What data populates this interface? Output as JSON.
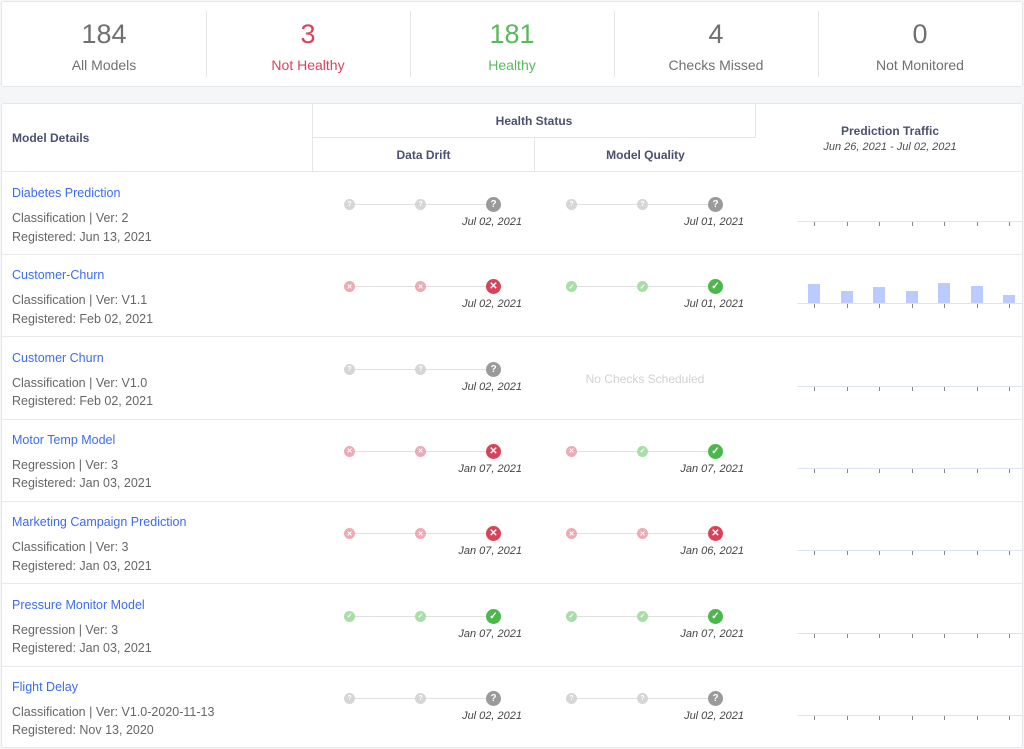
{
  "summary": [
    {
      "value": "184",
      "label": "All Models",
      "color": "#707070"
    },
    {
      "value": "3",
      "label": "Not Healthy",
      "color": "#d9435a"
    },
    {
      "value": "181",
      "label": "Healthy",
      "color": "#5cb85c"
    },
    {
      "value": "4",
      "label": "Checks Missed",
      "color": "#707070"
    },
    {
      "value": "0",
      "label": "Not Monitored",
      "color": "#707070"
    }
  ],
  "table": {
    "headers": {
      "model_details": "Model Details",
      "health_status": "Health Status",
      "data_drift": "Data Drift",
      "model_quality": "Model Quality",
      "prediction_traffic": "Prediction Traffic",
      "traffic_range": "Jun 26, 2021 - Jul 02, 2021"
    },
    "no_checks_label": "No Checks Scheduled",
    "status_icons": {
      "unknown": "question-icon",
      "fail": "x-icon",
      "pass": "check-icon"
    },
    "rows": [
      {
        "name": "Diabetes Prediction",
        "type_version": "Classification | Ver: 2",
        "registered": "Registered: Jun 13, 2021",
        "drift": {
          "statuses": [
            "unknown",
            "unknown",
            "unknown"
          ],
          "date": "Jul 02, 2021"
        },
        "quality": {
          "statuses": [
            "unknown",
            "unknown",
            "unknown"
          ],
          "date": "Jul 01, 2021"
        },
        "traffic": [
          0,
          0,
          0,
          0,
          0,
          0,
          0
        ]
      },
      {
        "name": "Customer-Churn",
        "type_version": "Classification | Ver: V1.1",
        "registered": "Registered: Feb 02, 2021",
        "drift": {
          "statuses": [
            "fail",
            "fail",
            "fail"
          ],
          "date": "Jul 02, 2021"
        },
        "quality": {
          "statuses": [
            "pass",
            "pass",
            "pass"
          ],
          "date": "Jul 01, 2021"
        },
        "traffic": [
          0.95,
          0.6,
          0.8,
          0.6,
          1.0,
          0.85,
          0.42
        ]
      },
      {
        "name": "Customer Churn",
        "type_version": "Classification | Ver: V1.0",
        "registered": "Registered: Feb 02, 2021",
        "drift": {
          "statuses": [
            "unknown",
            "unknown",
            "unknown"
          ],
          "date": "Jul 02, 2021"
        },
        "quality": null,
        "traffic": [
          0,
          0,
          0,
          0,
          0,
          0,
          0
        ]
      },
      {
        "name": "Motor Temp Model",
        "type_version": "Regression | Ver: 3",
        "registered": "Registered: Jan 03, 2021",
        "drift": {
          "statuses": [
            "fail",
            "fail",
            "fail"
          ],
          "date": "Jan 07, 2021"
        },
        "quality": {
          "statuses": [
            "fail",
            "pass",
            "pass"
          ],
          "date": "Jan 07, 2021"
        },
        "traffic": [
          0,
          0,
          0,
          0,
          0,
          0,
          0
        ]
      },
      {
        "name": "Marketing Campaign Prediction",
        "type_version": "Classification | Ver: 3",
        "registered": "Registered: Jan 03, 2021",
        "drift": {
          "statuses": [
            "fail",
            "fail",
            "fail"
          ],
          "date": "Jan 07, 2021"
        },
        "quality": {
          "statuses": [
            "fail",
            "fail",
            "fail"
          ],
          "date": "Jan 06, 2021"
        },
        "traffic": [
          0,
          0,
          0,
          0,
          0,
          0,
          0
        ]
      },
      {
        "name": "Pressure Monitor Model",
        "type_version": "Regression | Ver: 3",
        "registered": "Registered: Jan 03, 2021",
        "drift": {
          "statuses": [
            "pass",
            "pass",
            "pass"
          ],
          "date": "Jan 07, 2021"
        },
        "quality": {
          "statuses": [
            "pass",
            "pass",
            "pass"
          ],
          "date": "Jan 07, 2021"
        },
        "traffic": [
          0,
          0,
          0,
          0,
          0,
          0,
          0
        ]
      },
      {
        "name": "Flight Delay",
        "type_version": "Classification | Ver: V1.0-2020-11-13",
        "registered": "Registered: Nov 13, 2020",
        "drift": {
          "statuses": [
            "unknown",
            "unknown",
            "unknown"
          ],
          "date": "Jul 02, 2021"
        },
        "quality": {
          "statuses": [
            "unknown",
            "unknown",
            "unknown"
          ],
          "date": "Jul 02, 2021"
        },
        "traffic": [
          0,
          0,
          0,
          0,
          0,
          0,
          0
        ]
      }
    ]
  }
}
